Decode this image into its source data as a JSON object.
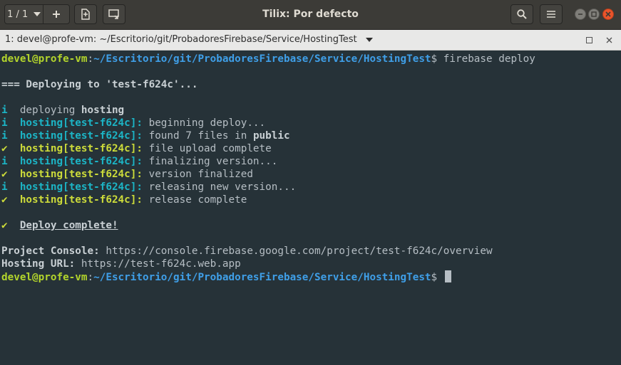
{
  "window": {
    "title": "Tilix: Por defecto",
    "session_indicator": "1 / 1"
  },
  "terminal_header": {
    "label": "1: devel@profe-vm: ~/Escritorio/git/ProbadoresFirebase/Service/HostingTest"
  },
  "prompt": {
    "user_host": "devel@profe-vm",
    "path": "~/Escritorio/git/ProbadoresFirebase/Service/HostingTest"
  },
  "lines": {
    "cmd": "firebase deploy",
    "deploying": "=== Deploying to 'test-f624c'...",
    "info_mark": "i",
    "check_mark": "✔",
    "deploying_word": "deploying",
    "hosting_word": "hosting",
    "hosting_tag": "hosting[test-f624c]:",
    "l1": "beginning deploy...",
    "l2_pre": "found 7 files in",
    "l2_bold": "public",
    "l3": "file upload complete",
    "l4": "finalizing version...",
    "l5": "version finalized",
    "l6": "releasing new version...",
    "l7": "release complete",
    "complete": "Deploy complete!",
    "console_label": "Project Console:",
    "console_url": "https://console.firebase.google.com/project/test-f624c/overview",
    "hosting_label": "Hosting URL:",
    "hosting_url": "https://test-f624c.web.app"
  },
  "colors": {
    "terminal_bg": "#263238",
    "prompt_green": "#b3d52c",
    "path_blue": "#3f9fe8",
    "hosting_cyan": "#1cb5c6",
    "success_yellow": "#cddc3a",
    "titlebar_bg": "#3c3b37",
    "close_orange": "#e9542b"
  },
  "icons": {
    "session_dropdown": "chevron-down-icon",
    "add_terminal": "plus-icon",
    "split": "add-terminal-right-icon",
    "sync_input": "sync-input-icon",
    "search": "search-icon",
    "menu": "hamburger-menu-icon",
    "minimize": "minimize-icon",
    "maximize": "maximize-icon",
    "close": "close-icon"
  }
}
